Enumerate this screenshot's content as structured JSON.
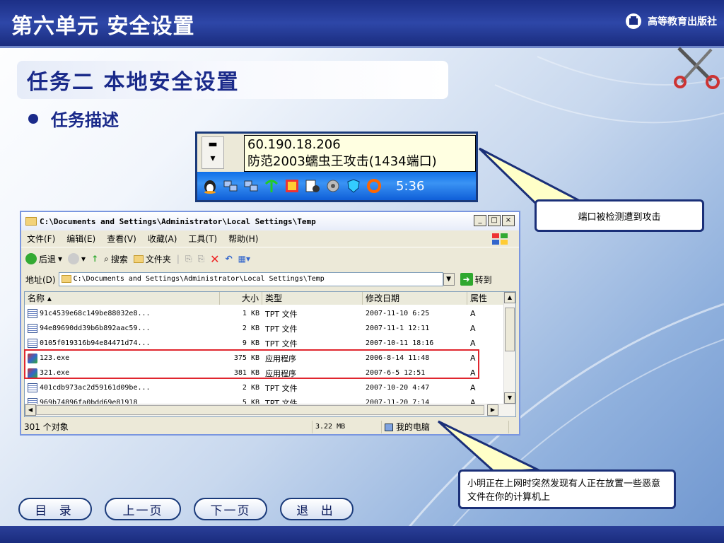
{
  "slide": {
    "banner_title": "第六单元  安全设置",
    "publisher": "高等教育出版社",
    "task_heading": "任务二  本地安全设置",
    "bullet": "任务描述"
  },
  "tray": {
    "tooltip_line1": "60.190.18.206",
    "tooltip_line2": "防范2003蠕虫王攻击(1434端口)",
    "time": "5:36",
    "icons": [
      "qq-penguin-icon",
      "network-icon",
      "network-icon",
      "antenna-icon",
      "firewall-icon",
      "media-icon",
      "speaker-icon",
      "shield-icon",
      "refresh-icon"
    ]
  },
  "explorer": {
    "title": "C:\\Documents and Settings\\Administrator\\Local Settings\\Temp",
    "menu": [
      "文件(F)",
      "编辑(E)",
      "查看(V)",
      "收藏(A)",
      "工具(T)",
      "帮助(H)"
    ],
    "toolbar": {
      "back": "后退",
      "search": "搜索",
      "folders": "文件夹"
    },
    "address_label": "地址(D)",
    "address": "C:\\Documents and Settings\\Administrator\\Local Settings\\Temp",
    "go": "转到",
    "columns": [
      "名称",
      "大小",
      "类型",
      "修改日期",
      "属性"
    ],
    "rows": [
      {
        "name": "91c4539e68c149be88032e8...",
        "size": "1 KB",
        "type": "TPT 文件",
        "date": "2007-11-10 6:25",
        "attr": "A",
        "icon": "file"
      },
      {
        "name": "94e89690dd39b6b892aac59...",
        "size": "2 KB",
        "type": "TPT 文件",
        "date": "2007-11-1 12:11",
        "attr": "A",
        "icon": "file"
      },
      {
        "name": "0105f019316b94e84471d74...",
        "size": "9 KB",
        "type": "TPT 文件",
        "date": "2007-10-11 18:16",
        "attr": "A",
        "icon": "file"
      },
      {
        "name": "123.exe",
        "size": "375 KB",
        "type": "应用程序",
        "date": "2006-8-14 11:48",
        "attr": "A",
        "icon": "exe"
      },
      {
        "name": "321.exe",
        "size": "381 KB",
        "type": "应用程序",
        "date": "2007-6-5 12:51",
        "attr": "A",
        "icon": "exe"
      },
      {
        "name": "401cdb973ac2d59161d09be...",
        "size": "2 KB",
        "type": "TPT 文件",
        "date": "2007-10-20 4:47",
        "attr": "A",
        "icon": "file"
      },
      {
        "name": "969b74896fa0bdd69e81918",
        "size": "5 KB",
        "type": "TPT 文件",
        "date": "2007-11-20 7:14",
        "attr": "A",
        "icon": "file"
      }
    ],
    "status": {
      "count": "301 个对象",
      "size": "3.22 MB",
      "zone": "我的电脑"
    }
  },
  "callouts": {
    "port_attack": "端口被检测遭到攻击",
    "malicious_files": "小明正在上网时突然发现有人正在放置一些恶意文件在你的计算机上"
  },
  "nav": {
    "contents": "目 录",
    "prev": "上一页",
    "next": "下一页",
    "exit": "退 出"
  }
}
